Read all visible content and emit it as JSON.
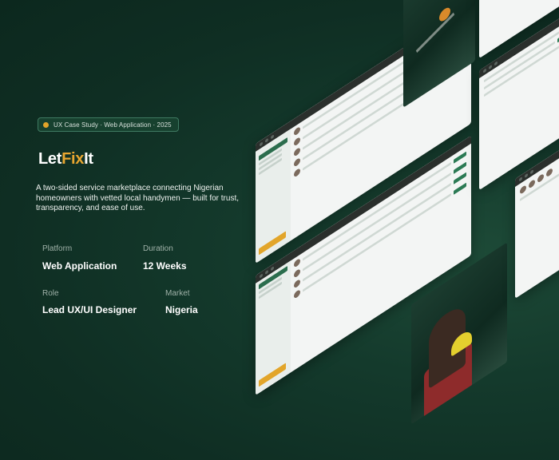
{
  "badge": {
    "text": "UX Case Study · Web Application · 2025"
  },
  "logo": {
    "part1": "Let",
    "part2": "Fix",
    "part3": "It"
  },
  "description": "A two-sided service marketplace connecting Nigerian homeowners with vetted local handymen — built for trust, transparency, and ease of use.",
  "meta": {
    "platform_label": "Platform",
    "platform_value": "Web Application",
    "duration_label": "Duration",
    "duration_value": "12 Weeks",
    "role_label": "Role",
    "role_value": "Lead UX/UI Designer",
    "market_label": "Market",
    "market_value": "Nigeria"
  },
  "colors": {
    "background": "#0f2e23",
    "accent_gold": "#e8a630",
    "brand_green": "#2b6d4d"
  }
}
